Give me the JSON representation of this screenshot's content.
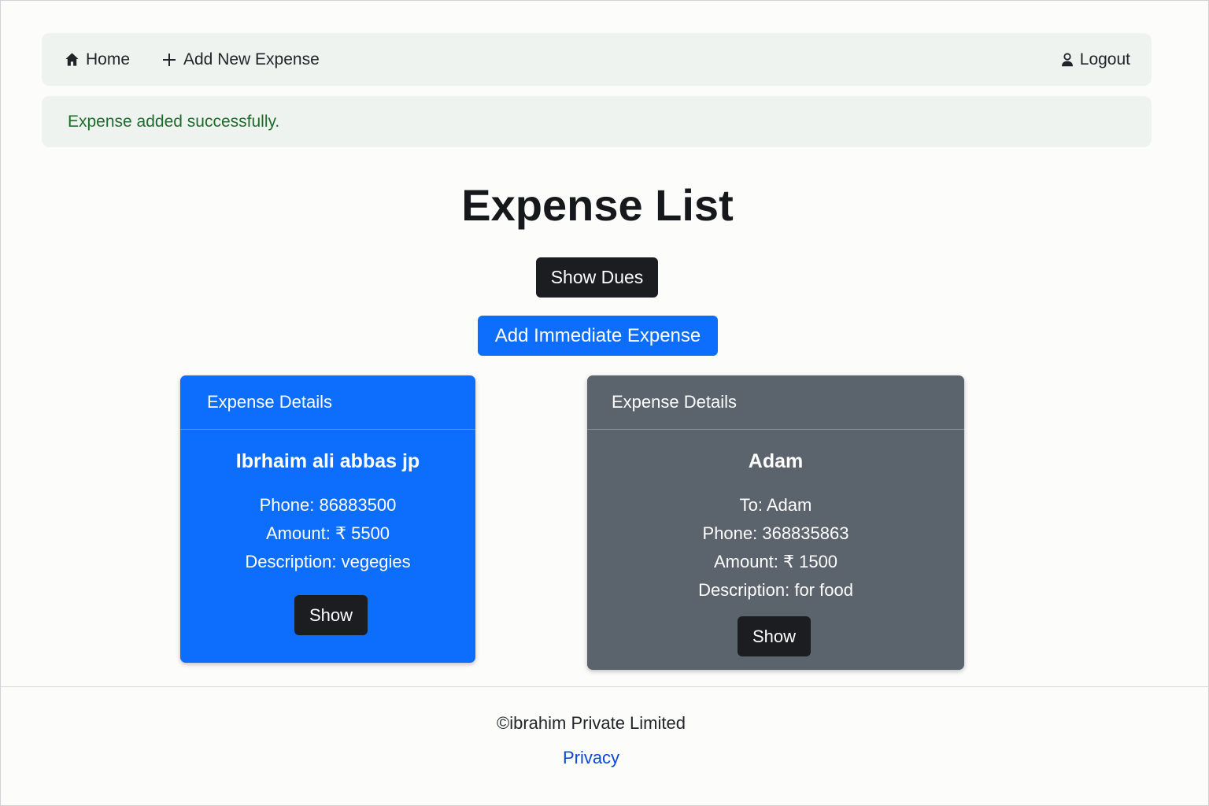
{
  "nav": {
    "home_label": "Home",
    "add_label": "Add New Expense",
    "logout_label": "Logout",
    "home_icon": "home-icon",
    "add_icon": "plus-icon",
    "logout_icon": "user-icon"
  },
  "alert": {
    "message": "Expense added successfully."
  },
  "page": {
    "title": "Expense List"
  },
  "actions": {
    "show_dues_label": "Show Dues",
    "add_immediate_label": "Add Immediate Expense"
  },
  "cards": [
    {
      "header": "Expense Details",
      "name": "Ibrhaim ali abbas jp",
      "phone": "Phone: 86883500",
      "amount": "Amount: ₹ 5500",
      "description": "Description: vegegies",
      "button_label": "Show",
      "color": "#0d6efd"
    },
    {
      "header": "Expense Details",
      "name": "Adam",
      "to": "To: Adam",
      "phone": "Phone: 368835863",
      "amount": "Amount: ₹ 1500",
      "description": "Description: for food",
      "button_label": "Show",
      "color": "#5b636c"
    }
  ],
  "footer": {
    "copyright": "©ibrahim Private Limited",
    "privacy_label": "Privacy"
  },
  "colors": {
    "primary": "#0d6efd",
    "dark": "#1b1d20",
    "secondary": "#5b636c",
    "success_text": "#1e6b2c"
  }
}
